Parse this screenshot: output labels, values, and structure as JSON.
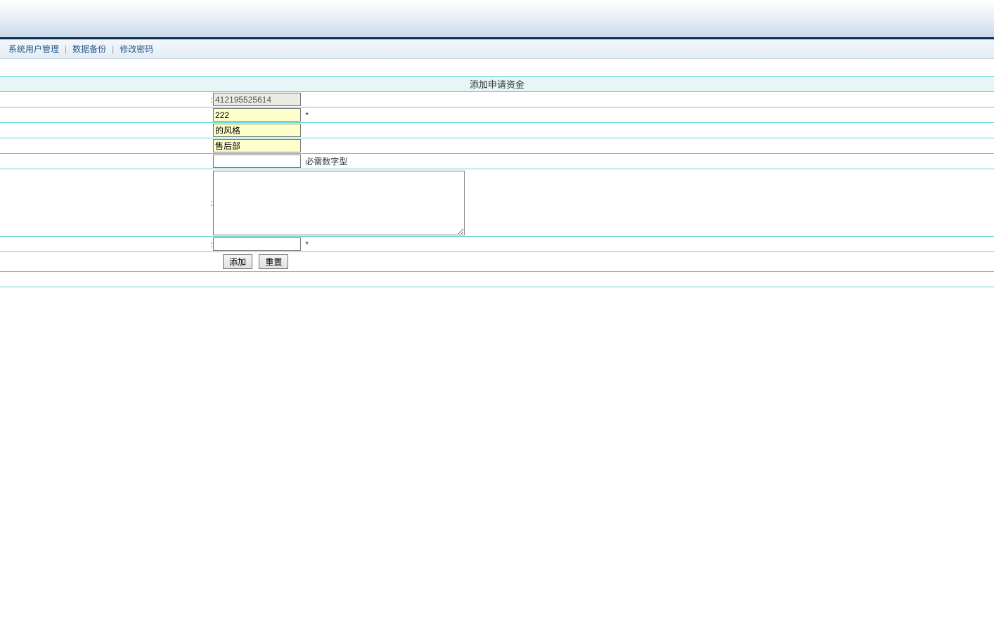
{
  "nav": {
    "items": [
      {
        "label": "系统用户管理"
      },
      {
        "label": "数据备份"
      },
      {
        "label": "修改密码"
      }
    ]
  },
  "form": {
    "title": "添加申请资金",
    "rows": [
      {
        "label": ":",
        "value": "412195525614",
        "suffix": ""
      },
      {
        "label": "",
        "value": "222",
        "suffix": "*"
      },
      {
        "label": "",
        "value": "的风格",
        "suffix": ""
      },
      {
        "label": "",
        "value": "售后部",
        "suffix": ""
      },
      {
        "label": "",
        "value": "",
        "suffix": "必需数字型"
      },
      {
        "label": ":",
        "value": "",
        "suffix": ""
      },
      {
        "label": ":",
        "value": "",
        "suffix": "*"
      }
    ],
    "buttons": {
      "submit": "添加",
      "reset": "重置"
    }
  }
}
